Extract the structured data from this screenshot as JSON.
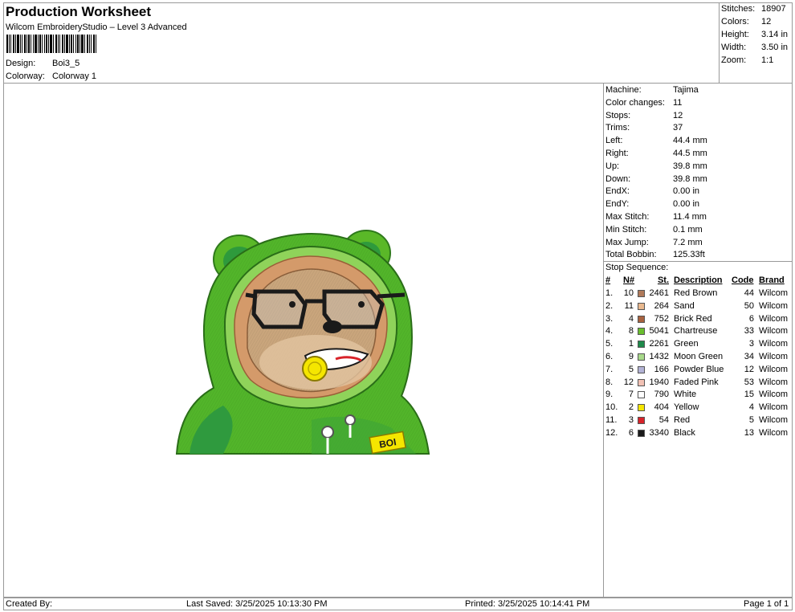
{
  "header": {
    "title": "Production Worksheet",
    "subtitle": "Wilcom EmbroideryStudio – Level 3 Advanced",
    "design_label": "Design:",
    "design_value": "Boi3_5",
    "colorway_label": "Colorway:",
    "colorway_value": "Colorway 1"
  },
  "stats": [
    {
      "label": "Stitches:",
      "value": "18907"
    },
    {
      "label": "Colors:",
      "value": "12"
    },
    {
      "label": "Height:",
      "value": "3.14 in"
    },
    {
      "label": "Width:",
      "value": "3.50 in"
    },
    {
      "label": "Zoom:",
      "value": "1:1"
    }
  ],
  "machine_info": [
    {
      "label": "Machine:",
      "value": "Tajima"
    },
    {
      "label": "Color changes:",
      "value": "11"
    },
    {
      "label": "Stops:",
      "value": "12"
    },
    {
      "label": "Trims:",
      "value": "37"
    },
    {
      "label": "Left:",
      "value": "44.4 mm"
    },
    {
      "label": "Right:",
      "value": "44.5 mm"
    },
    {
      "label": "Up:",
      "value": "39.8 mm"
    },
    {
      "label": "Down:",
      "value": "39.8 mm"
    },
    {
      "label": "EndX:",
      "value": "0.00 in"
    },
    {
      "label": "EndY:",
      "value": "0.00 in"
    },
    {
      "label": "Max Stitch:",
      "value": "11.4 mm"
    },
    {
      "label": "Min Stitch:",
      "value": "0.1 mm"
    },
    {
      "label": "Max Jump:",
      "value": "7.2 mm"
    },
    {
      "label": "Total Bobbin:",
      "value": "125.33ft"
    }
  ],
  "stop_sequence": {
    "title": "Stop Sequence:",
    "headers": {
      "num": "#",
      "n": "N#",
      "st": "St.",
      "description": "Description",
      "code": "Code",
      "brand": "Brand"
    },
    "rows": [
      {
        "num": "1.",
        "n": "10",
        "color": "#b07a5a",
        "st": "2461",
        "description": "Red Brown",
        "code": "44",
        "brand": "Wilcom"
      },
      {
        "num": "2.",
        "n": "11",
        "color": "#e9b98f",
        "st": "264",
        "description": "Sand",
        "code": "50",
        "brand": "Wilcom"
      },
      {
        "num": "3.",
        "n": "4",
        "color": "#a8623f",
        "st": "752",
        "description": "Brick Red",
        "code": "6",
        "brand": "Wilcom"
      },
      {
        "num": "4.",
        "n": "8",
        "color": "#6abf2e",
        "st": "5041",
        "description": "Chartreuse",
        "code": "33",
        "brand": "Wilcom"
      },
      {
        "num": "5.",
        "n": "1",
        "color": "#1e8a4a",
        "st": "2261",
        "description": "Green",
        "code": "3",
        "brand": "Wilcom"
      },
      {
        "num": "6.",
        "n": "9",
        "color": "#a8d98a",
        "st": "1432",
        "description": "Moon Green",
        "code": "34",
        "brand": "Wilcom"
      },
      {
        "num": "7.",
        "n": "5",
        "color": "#b3b3d6",
        "st": "166",
        "description": "Powder Blue",
        "code": "12",
        "brand": "Wilcom"
      },
      {
        "num": "8.",
        "n": "12",
        "color": "#f2c2b5",
        "st": "1940",
        "description": "Faded Pink",
        "code": "53",
        "brand": "Wilcom"
      },
      {
        "num": "9.",
        "n": "7",
        "color": "#ffffff",
        "st": "790",
        "description": "White",
        "code": "15",
        "brand": "Wilcom"
      },
      {
        "num": "10.",
        "n": "2",
        "color": "#f5e600",
        "st": "404",
        "description": "Yellow",
        "code": "4",
        "brand": "Wilcom"
      },
      {
        "num": "11.",
        "n": "3",
        "color": "#d8232a",
        "st": "54",
        "description": "Red",
        "code": "5",
        "brand": "Wilcom"
      },
      {
        "num": "12.",
        "n": "6",
        "color": "#1a1a1a",
        "st": "3340",
        "description": "Black",
        "code": "13",
        "brand": "Wilcom"
      }
    ]
  },
  "footer": {
    "created_by": "Created By:",
    "last_saved": "Last Saved: 3/25/2025 10:13:30 PM",
    "printed": "Printed: 3/25/2025 10:14:41 PM",
    "page": "Page 1 of 1"
  },
  "design_art": {
    "badge_text": "BOI"
  }
}
